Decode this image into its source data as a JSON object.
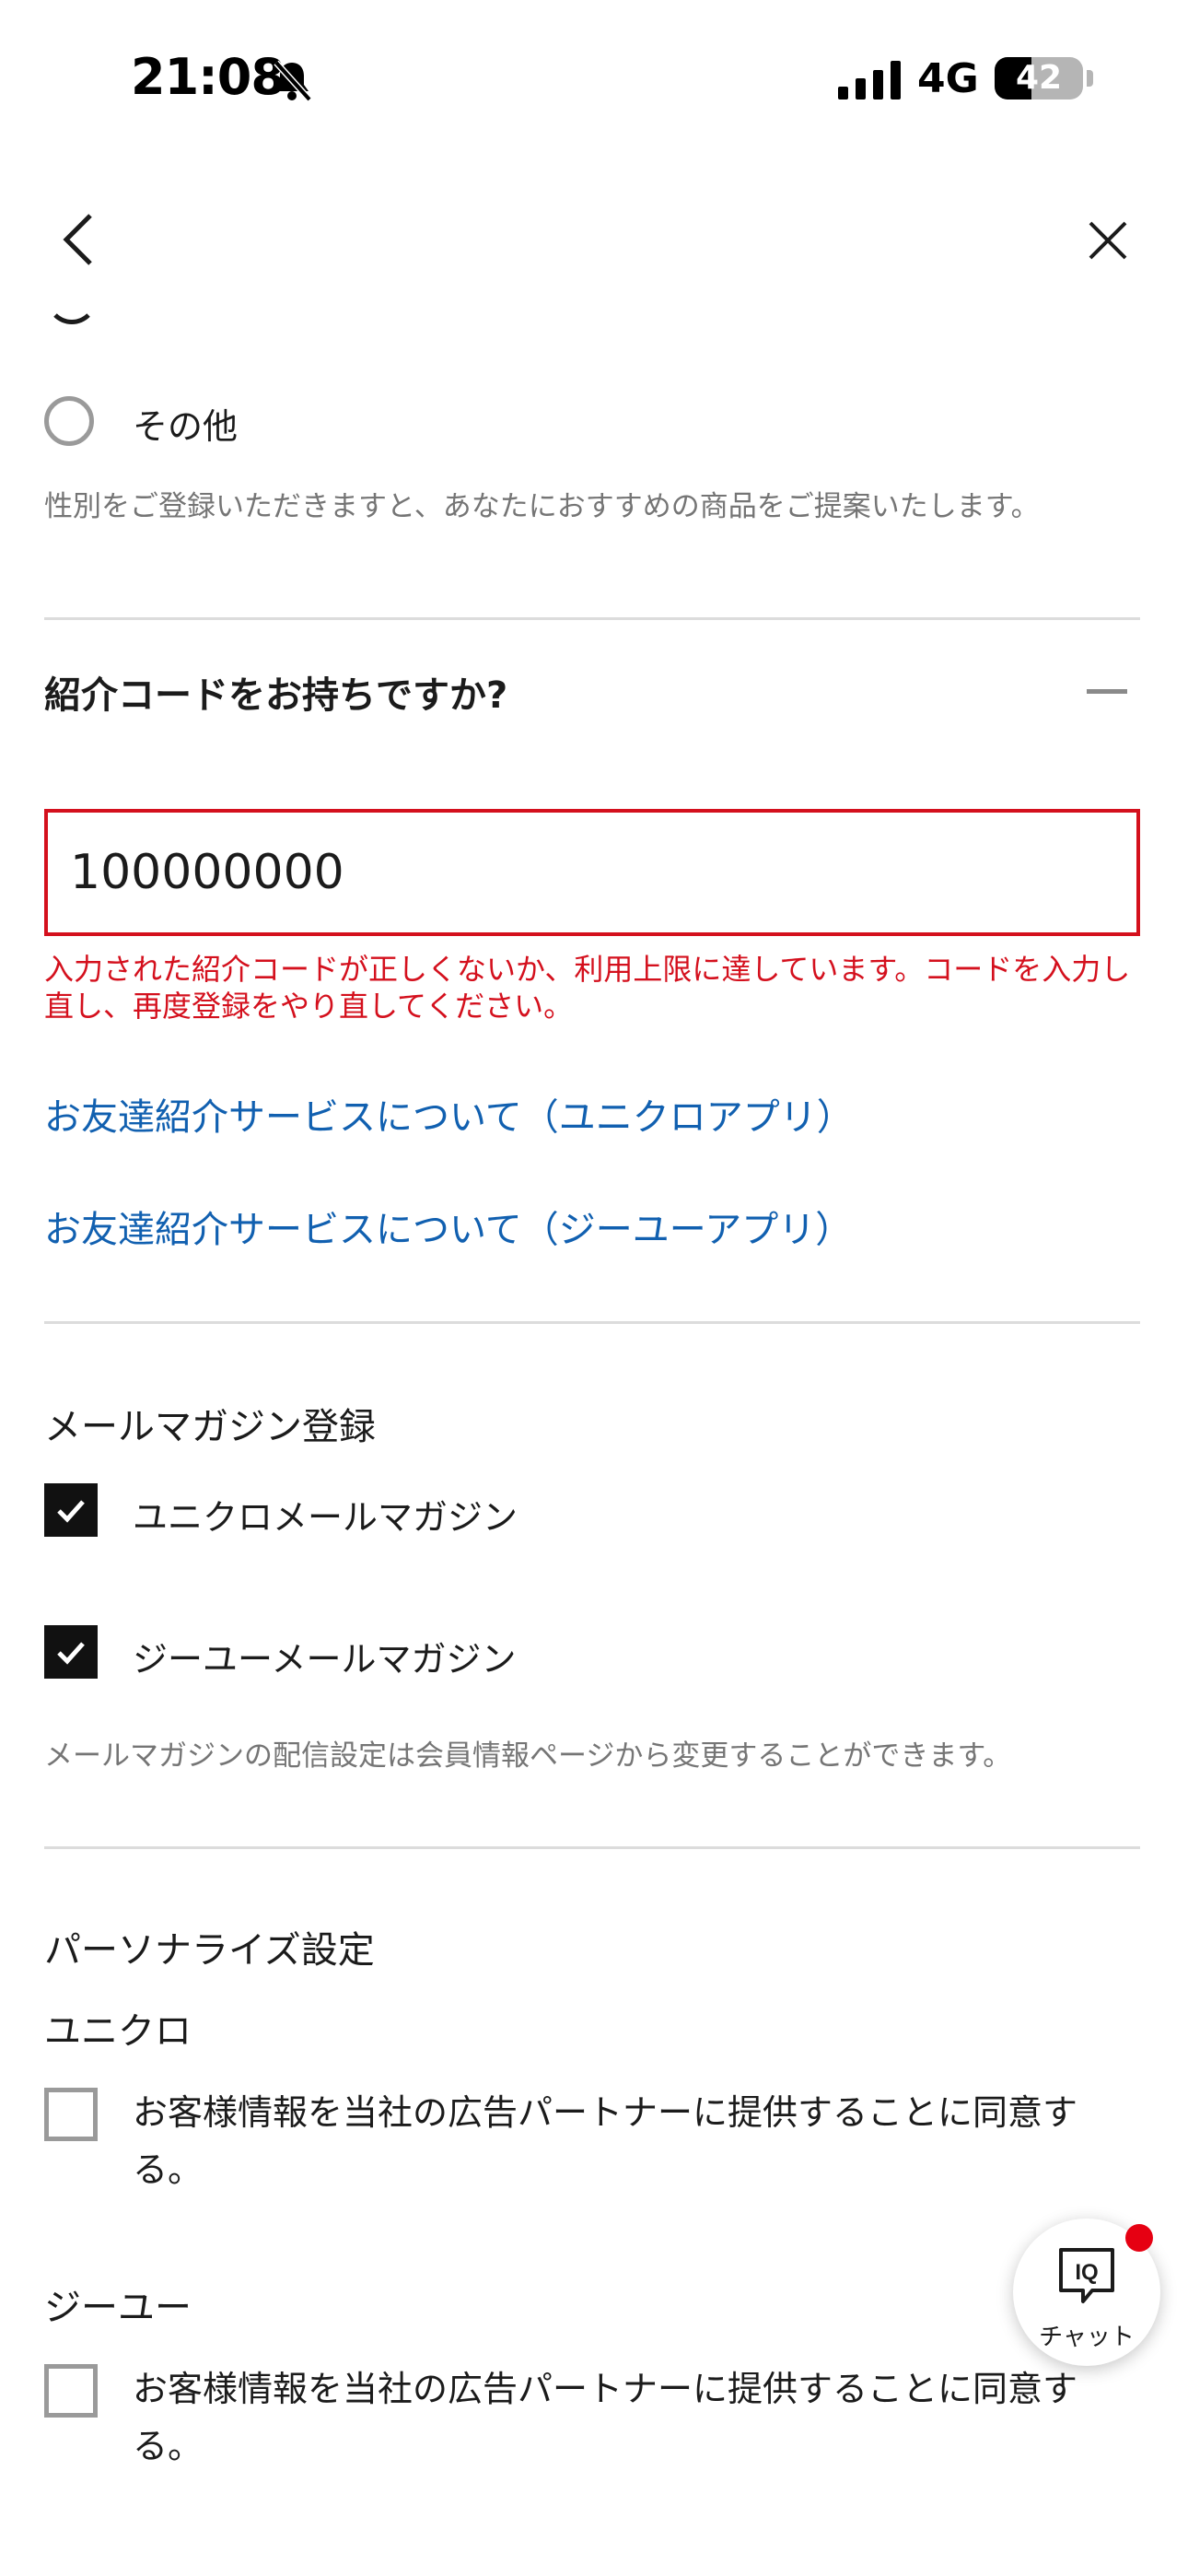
{
  "status_bar": {
    "time": "21:08",
    "network": "4G",
    "battery": "42",
    "battery_level": 0.42
  },
  "nav": {
    "back_icon": "chevron-left-icon",
    "close_icon": "close-icon"
  },
  "gender": {
    "option_other": "その他",
    "note": "性別をご登録いただきますと、あなたにおすすめの商品をご提案いたします。"
  },
  "referral": {
    "title": "紹介コードをお持ちですか?",
    "code_value": "100000000",
    "error": "入力された紹介コードが正しくないか、利用上限に達しています。コードを入力し直し、再度登録をやり直してください。",
    "link_uniqlo": "お友達紹介サービスについて（ユニクロアプリ）",
    "link_gu": "お友達紹介サービスについて（ジーユーアプリ）",
    "error_color": "#d4101d",
    "link_color": "#1160b0"
  },
  "newsletter": {
    "title": "メールマガジン登録",
    "uniqlo": "ユニクロメールマガジン",
    "uniqlo_checked": true,
    "gu": "ジーユーメールマガジン",
    "gu_checked": true,
    "note": "メールマガジンの配信設定は会員情報ページから変更することができます。"
  },
  "personalize": {
    "title": "パーソナライズ設定",
    "uniqlo_heading": "ユニクロ",
    "uniqlo_consent": "お客様情報を当社の広告パートナーに提供することに同意する。",
    "gu_heading": "ジーユー",
    "gu_consent": "お客様情報を当社の広告パートナーに提供することに同意する。"
  },
  "chat": {
    "label": "チャット",
    "icon_text": "IQ",
    "badge_color": "#e60012"
  }
}
